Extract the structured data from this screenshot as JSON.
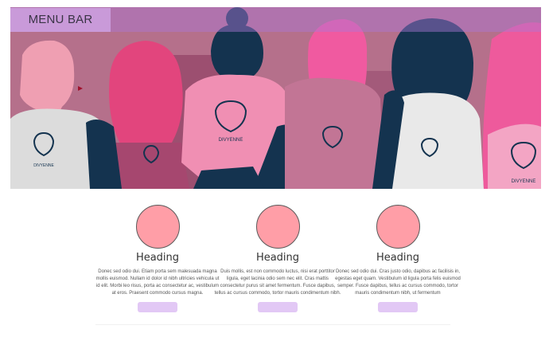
{
  "menu": {
    "label": "MENU BAR"
  },
  "hero": {
    "badge_text": "DIVYENNE"
  },
  "cards": [
    {
      "heading": "Heading",
      "body": "Donec sed odio dui. Etiam porta sem malesuada magna mollis euismod. Nullam id dolor id nibh ultricies vehicula ut id elit. Morbi leo risus, porta ac consectetur ac, vestibulum at eros. Praesent commodo cursus magna."
    },
    {
      "heading": "Heading",
      "body": "Duis mollis, est non commodo luctus, nisi erat porttitor ligula, eget lacinia odio sem nec elit. Cras mattis consectetur purus sit amet fermentum. Fusce dapibus, tellus ac cursus commodo, tortor mauris condimentum nibh."
    },
    {
      "heading": "Heading",
      "body": "Donec sed odio dui. Cras justo odio, dapibus ac facilisis in, egestas eget quam. Vestibulum id ligula porta felis euismod semper. Fusce dapibus, tellus ac cursus commodo, tortor mauris condimentum nibh, ut fermentum"
    }
  ],
  "colors": {
    "menu_bar": "#c99ad9",
    "circle": "#ff9ea7",
    "cta": "#e2c8f5",
    "hero_bg": "#b5708b"
  }
}
